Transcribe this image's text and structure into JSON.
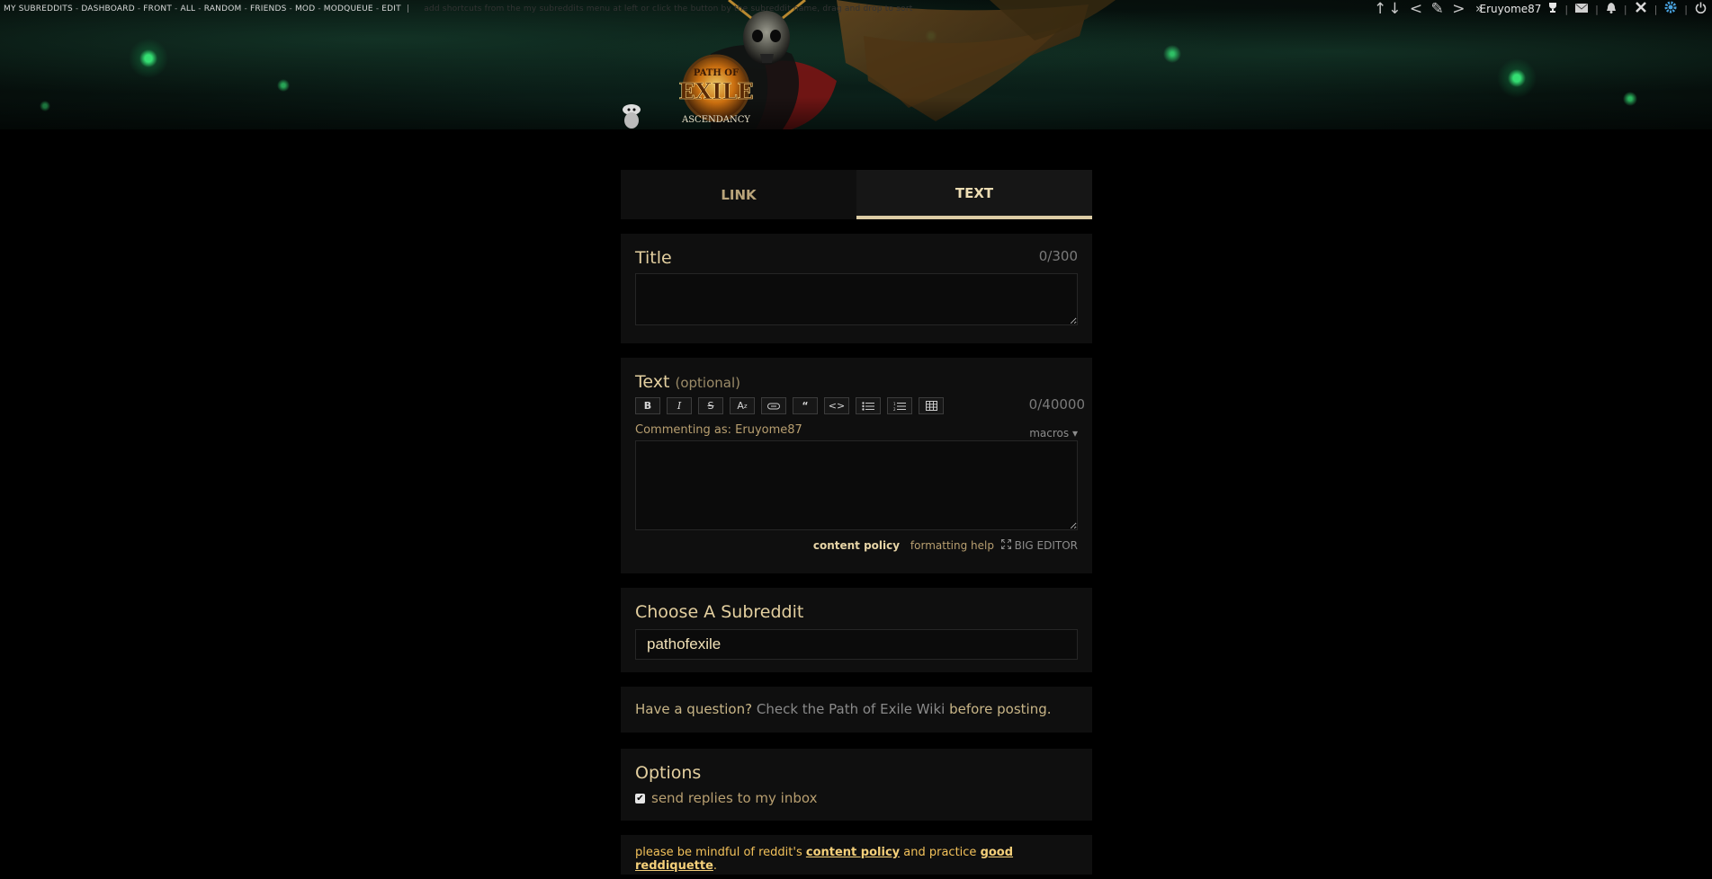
{
  "top_nav": {
    "items": [
      "MY SUBREDDITS",
      "DASHBOARD",
      "FRONT",
      "ALL",
      "RANDOM",
      "FRIENDS",
      "MOD",
      "MODQUEUE",
      "EDIT"
    ],
    "separator": "-",
    "divider": "|",
    "hint": "add shortcuts from the my subreddits menu at left or click the button by the subreddit name, drag and drop to sort"
  },
  "user_bar": {
    "sort_glyphs": "↑↓ < ✎ >",
    "more_glyph": "»",
    "username": "Eruyome87"
  },
  "header": {
    "logo_top": "PATH OF",
    "logo_main": "EXILE",
    "logo_sub": "ASCENDANCY"
  },
  "tabs": [
    {
      "label": "LINK",
      "active": false
    },
    {
      "label": "TEXT",
      "active": true
    }
  ],
  "title_section": {
    "label": "Title",
    "counter": "0/300",
    "value": ""
  },
  "text_section": {
    "label": "Text",
    "optional": "(optional)",
    "counter": "0/40000",
    "commenting_as": "Commenting as: Eruyome87",
    "macros": "macros",
    "value": "",
    "links": {
      "content_policy": "content policy",
      "formatting_help": "formatting help",
      "big_editor": "BIG EDITOR"
    },
    "toolbar": [
      "B",
      "I",
      "S",
      "A",
      "link",
      "“",
      "<>",
      "ul",
      "ol",
      "table"
    ]
  },
  "subreddit_section": {
    "label": "Choose A Subreddit",
    "value": "pathofexile"
  },
  "question_section": {
    "prefix": "Have a question?",
    "wiki": "Check the Path of Exile Wiki",
    "suffix": "before posting."
  },
  "options_section": {
    "label": "Options",
    "checkbox_label": "send replies to my inbox",
    "checked": true
  },
  "notice": {
    "prefix": "please be mindful of reddit's",
    "content_policy": "content policy",
    "middle": "and practice",
    "reddiquette": "good reddiquette",
    "suffix": "."
  },
  "colors": {
    "accent_gold": "#e3cf9f",
    "panel_bg": "#0f0f0f",
    "page_bg": "#000000",
    "link_tan": "#b89f70",
    "notice_orange": "#f2c15a"
  }
}
